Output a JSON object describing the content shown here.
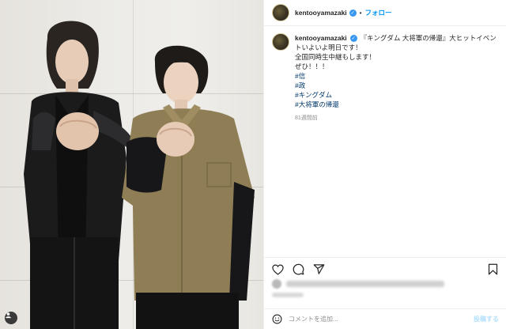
{
  "account": {
    "username": "kentooyamazaki",
    "verified": true,
    "separator": "•",
    "follow_label": "フォロー"
  },
  "caption": {
    "username": "kentooyamazaki",
    "lines": [
      "『キングダム 大将軍の帰還』大ヒットイベントいよいよ明日です！",
      "全国同時生中継もします！",
      "ぜひ！！！"
    ],
    "hashtags": [
      "#信",
      "#政",
      "#キングダム",
      "#大将軍の帰還"
    ],
    "time_ago": "81週間前"
  },
  "actions": {
    "like": "heart-icon",
    "comment": "comment-icon",
    "share": "share-icon",
    "save": "bookmark-icon"
  },
  "comment_box": {
    "placeholder": "コメントを追加...",
    "post_label": "投稿する"
  },
  "colors": {
    "link_blue": "#0095f6",
    "hashtag": "#00376b",
    "verified": "#3897f0"
  }
}
